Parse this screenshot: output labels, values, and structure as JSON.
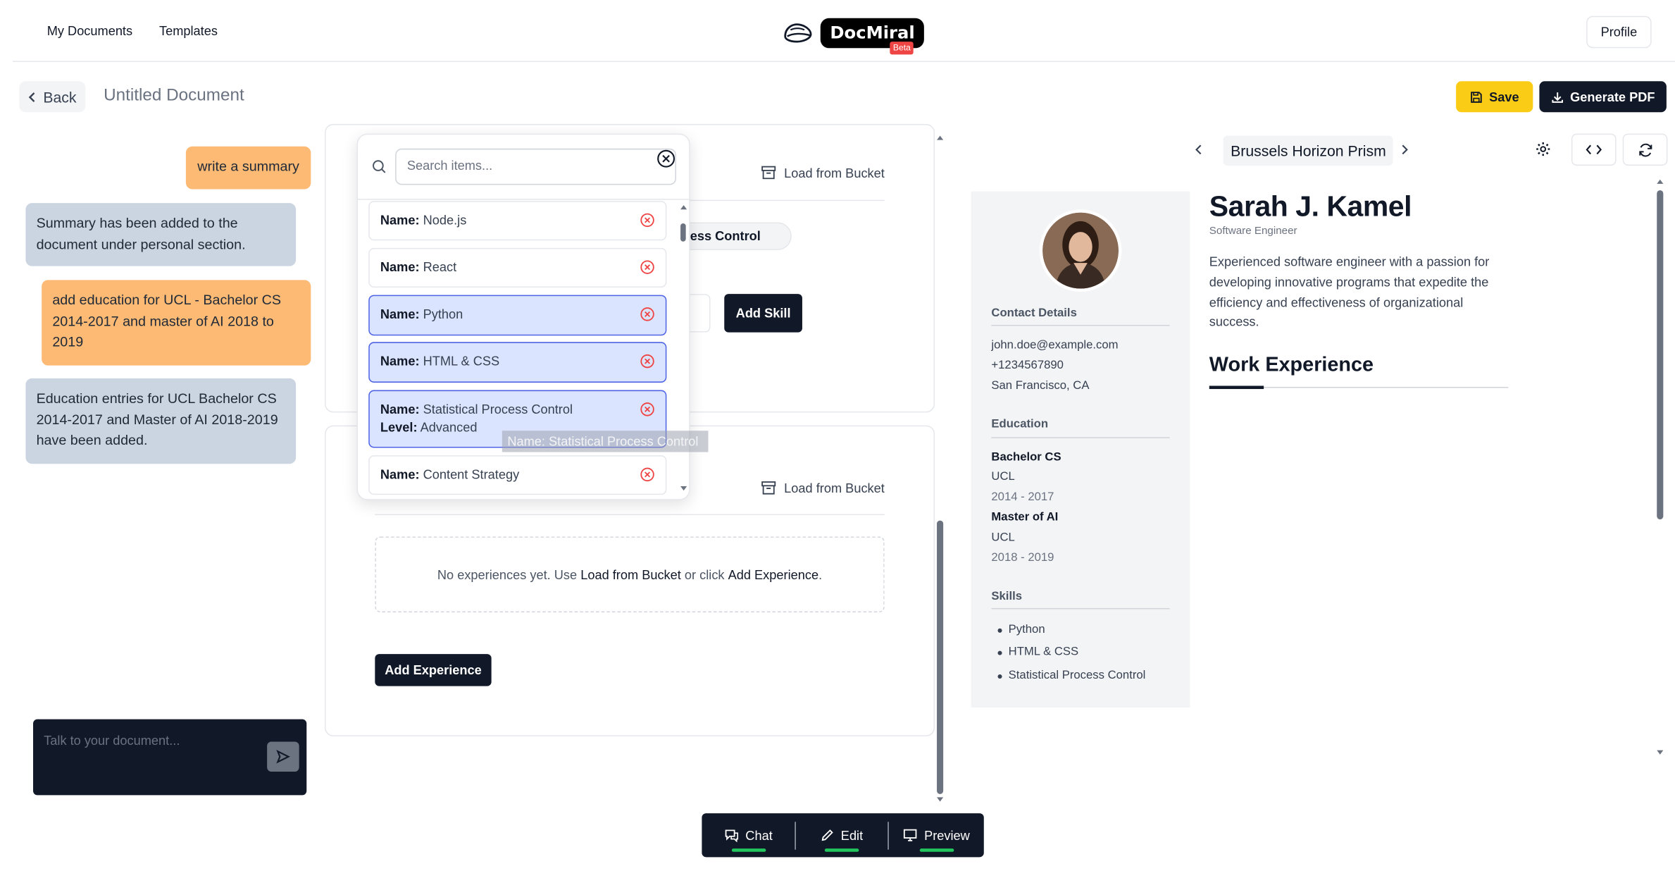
{
  "nav": {
    "my_documents": "My Documents",
    "templates": "Templates",
    "logo_text": "DocMiral",
    "beta": "Beta",
    "profile": "Profile"
  },
  "toolbar": {
    "back": "Back",
    "title": "Untitled Document",
    "save": "Save",
    "generate_pdf": "Generate PDF"
  },
  "chat": {
    "messages": [
      {
        "role": "user",
        "text": "write a summary"
      },
      {
        "role": "assistant",
        "text": "Summary has been added to the document under personal section."
      },
      {
        "role": "user",
        "text": "add education for UCL - Bachelor CS 2014-2017 and master of AI 2018 to 2019"
      },
      {
        "role": "assistant",
        "text": "Education entries for UCL Bachelor CS 2014-2017 and Master of AI 2018-2019 have been added."
      }
    ],
    "input_placeholder": "Talk to your document..."
  },
  "editor": {
    "load_from_bucket": "Load from Bucket",
    "skill_chip_partial": "ess Control",
    "add_skill": "Add Skill",
    "empty_prefix": "No experiences yet. Use ",
    "empty_load": "Load from Bucket",
    "empty_mid": " or click ",
    "empty_add": "Add Experience",
    "empty_suffix": ".",
    "add_experience": "Add Experience"
  },
  "dropdown": {
    "search_placeholder": "Search items...",
    "name_key": "Name:",
    "level_key": "Level:",
    "items": [
      {
        "name": "Node.js",
        "selected": false
      },
      {
        "name": "React",
        "selected": false
      },
      {
        "name": "Python",
        "selected": true
      },
      {
        "name": "HTML & CSS",
        "selected": true
      },
      {
        "name": "Statistical Process Control",
        "level": "Advanced",
        "selected": true
      },
      {
        "name": "Content Strategy",
        "selected": false
      }
    ],
    "drag_ghost": "Name: Statistical Process Control"
  },
  "modes": {
    "chat": "Chat",
    "edit": "Edit",
    "preview": "Preview"
  },
  "preview": {
    "template_name": "Brussels Horizon Prism",
    "resume": {
      "name": "Sarah J. Kamel",
      "role": "Software Engineer",
      "summary": "Experienced software engineer with a passion for developing innovative programs that expedite the efficiency and effectiveness of organizational success.",
      "work_heading": "Work Experience",
      "contact_heading": "Contact Details",
      "email": "john.doe@example.com",
      "phone": "+1234567890",
      "location": "San Francisco, CA",
      "education_heading": "Education",
      "education": [
        {
          "degree": "Bachelor CS",
          "school": "UCL",
          "years": "2014 - 2017"
        },
        {
          "degree": "Master of AI",
          "school": "UCL",
          "years": "2018 - 2019"
        }
      ],
      "skills_heading": "Skills",
      "skills": [
        "Python",
        "HTML & CSS",
        "Statistical Process Control"
      ]
    }
  },
  "colors": {
    "accent_yellow": "#facc15",
    "dark": "#111827",
    "user_bubble": "#fdba74",
    "bot_bubble": "#cbd5e1",
    "selected_item": "#dbe4fe",
    "mode_underline": "#22c55e",
    "remove_icon": "#ef4444"
  }
}
